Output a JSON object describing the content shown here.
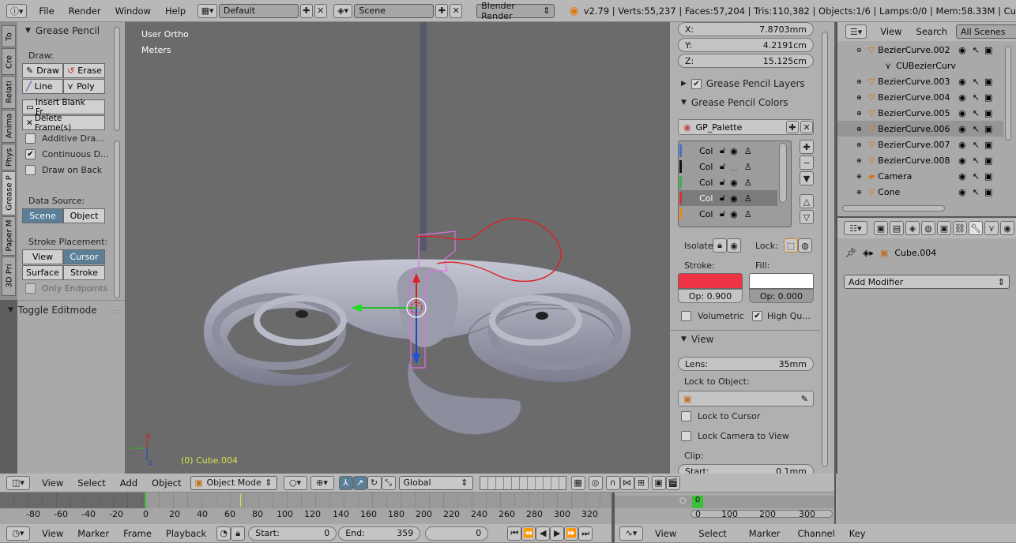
{
  "top_bar": {
    "menus": [
      "File",
      "Render",
      "Window",
      "Help"
    ],
    "layout": "Default",
    "scene": "Scene",
    "engine": "Blender Render",
    "stats": "v2.79 | Verts:55,237 | Faces:57,204 | Tris:110,382 | Objects:1/6 | Lamps:0/0 | Mem:58.33M | Cu"
  },
  "side_tabs": [
    "To",
    "Cre",
    "Relati",
    "Anima",
    "Phys",
    "Grease P",
    "Paper M",
    "3D Pri"
  ],
  "tool_panel": {
    "title": "Grease Pencil",
    "draw_label": "Draw:",
    "draw": "Draw",
    "erase": "Erase",
    "line": "Line",
    "poly": "Poly",
    "insert_blank": "Insert Blank Fr...",
    "delete_frames": "Delete Frame(s)",
    "additive": "Additive Dra...",
    "continuous": "Continuous D...",
    "draw_on_back": "Draw on Back",
    "data_source_label": "Data Source:",
    "scene_btn": "Scene",
    "object_btn": "Object",
    "stroke_placement_label": "Stroke Placement:",
    "view_btn": "View",
    "cursor_btn": "Cursor",
    "surface_btn": "Surface",
    "stroke_btn": "Stroke",
    "only_endpoints": "Only Endpoints",
    "toggle_editmode": "Toggle Editmode"
  },
  "viewport": {
    "view_name": "User Ortho",
    "units": "Meters",
    "object_label": "(0) Cube.004"
  },
  "properties": {
    "x_label": "X:",
    "x_value": "7.8703mm",
    "y_label": "Y:",
    "y_value": "4.2191cm",
    "z_label": "Z:",
    "z_value": "15.125cm",
    "gp_layers": "Grease Pencil Layers",
    "gp_colors": "Grease Pencil Colors",
    "palette": "GP_Palette",
    "color_items": [
      "Col",
      "Col",
      "Col",
      "Col",
      "Col"
    ],
    "color_swatches": [
      "#4a6fd0",
      "#111111",
      "#3ab04a",
      "#d03030",
      "#e08a20"
    ],
    "isolate": "Isolate:",
    "lock": "Lock:",
    "stroke_label": "Stroke:",
    "fill_label": "Fill:",
    "stroke_op": "Op: 0.900",
    "fill_op": "Op: 0.000",
    "stroke_color": "#ee3344",
    "fill_color": "#ffffff",
    "volumetric": "Volumetric",
    "high_quality": "High Qu...",
    "view_header": "View",
    "lens_label": "Lens:",
    "lens_value": "35mm",
    "lock_to_object": "Lock to Object:",
    "lock_to_cursor": "Lock to Cursor",
    "lock_camera": "Lock Camera to View",
    "clip": "Clip:",
    "start_clip": "Start:",
    "start_clip_value": "0.1mm"
  },
  "outliner": {
    "view": "View",
    "search": "Search",
    "filter": "All Scenes",
    "items": [
      "BezierCurve.002",
      "CUBezierCurv",
      "BezierCurve.003",
      "BezierCurve.004",
      "BezierCurve.005",
      "BezierCurve.006",
      "BezierCurve.007",
      "BezierCurve.008",
      "Camera",
      "Cone"
    ]
  },
  "modifiers": {
    "object_name": "Cube.004",
    "add_modifier": "Add Modifier"
  },
  "viewport_header": {
    "menus": [
      "View",
      "Select",
      "Add",
      "Object"
    ],
    "mode": "Object Mode",
    "orientation": "Global"
  },
  "timeline": {
    "ticks": [
      "-80",
      "-60",
      "-40",
      "-20",
      "0",
      "20",
      "40",
      "60",
      "80",
      "100",
      "120",
      "140",
      "160",
      "180",
      "200",
      "220",
      "240",
      "260",
      "280",
      "300",
      "320"
    ],
    "menus": [
      "View",
      "Marker",
      "Frame",
      "Playback"
    ],
    "start_label": "Start:",
    "start_value": "0",
    "end_label": "End:",
    "end_value": "359",
    "current": "0"
  },
  "graph": {
    "ticks": [
      "0",
      "100",
      "200",
      "300"
    ],
    "menus": [
      "View",
      "Select",
      "Marker",
      "Channel",
      "Key"
    ]
  }
}
